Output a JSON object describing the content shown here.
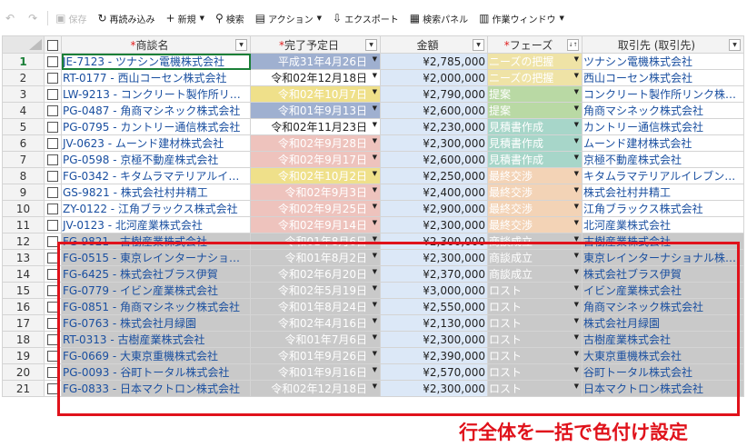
{
  "toolbar": {
    "items": [
      {
        "icon": "undo-icon",
        "glyph": "↶",
        "label": "",
        "disabled": true
      },
      {
        "icon": "redo-icon",
        "glyph": "↷",
        "label": "",
        "disabled": true
      },
      {
        "icon": "save-icon",
        "glyph": "▣",
        "label": "保存",
        "disabled": true
      },
      {
        "icon": "reload-icon",
        "glyph": "↻",
        "label": "再読み込み",
        "disabled": false
      },
      {
        "icon": "plus-icon",
        "glyph": "+",
        "label": "新規",
        "disabled": false,
        "caret": true
      },
      {
        "icon": "search-icon",
        "glyph": "⚲",
        "label": "検索",
        "disabled": false
      },
      {
        "icon": "action-icon",
        "glyph": "▤",
        "label": "アクション",
        "disabled": false,
        "caret": true
      },
      {
        "icon": "export-icon",
        "glyph": "⇩",
        "label": "エクスポート",
        "disabled": false
      },
      {
        "icon": "search-panel-icon",
        "glyph": "▦",
        "label": "検索パネル",
        "disabled": false
      },
      {
        "icon": "work-window-icon",
        "glyph": "▥",
        "label": "作業ウィンドウ",
        "disabled": false,
        "caret": true
      }
    ]
  },
  "grid": {
    "columns": [
      {
        "label": "商談名",
        "required": true
      },
      {
        "label": "完了予定日",
        "required": true
      },
      {
        "label": "金額",
        "required": false
      },
      {
        "label": "フェーズ",
        "required": true,
        "sort": "↓↑"
      },
      {
        "label": "取引先 (取引先)",
        "required": false
      }
    ],
    "filter_glyph": "▼",
    "rows": [
      {
        "n": "1",
        "deal": "JE-7123 - ツナシン電機株式会社",
        "date": "平成31年4月26日",
        "date_bg": "#9fb0d0",
        "amount": "¥2,785,000",
        "phase": "ニーズの把握",
        "phase_bg": "#efe3a6",
        "client": "ツナシン電機株式会社",
        "row_bg": ""
      },
      {
        "n": "2",
        "deal": "RT-0177 - 西山コーセン株式会社",
        "date": "令和02年12月18日",
        "date_bg": "",
        "amount": "¥2,000,000",
        "phase": "ニーズの把握",
        "phase_bg": "#efe3a6",
        "client": "西山コーセン株式会社",
        "row_bg": ""
      },
      {
        "n": "3",
        "deal": "LW-9213 - コンクリート製作所リンク株…",
        "date": "令和02年10月7日",
        "date_bg": "#efe08a",
        "amount": "¥2,790,000",
        "phase": "提案",
        "phase_bg": "#b9d9a4",
        "client": "コンクリート製作所リンク株式会社",
        "row_bg": ""
      },
      {
        "n": "4",
        "deal": "PG-0487 - 角商マシネック株式会社",
        "date": "令和01年9月13日",
        "date_bg": "#9fb0d0",
        "amount": "¥2,600,000",
        "phase": "提案",
        "phase_bg": "#b9d9a4",
        "client": "角商マシネック株式会社",
        "row_bg": ""
      },
      {
        "n": "5",
        "deal": "PG-0795 - カントリー通信株式会社",
        "date": "令和02年11月23日",
        "date_bg": "",
        "amount": "¥2,230,000",
        "phase": "見積書作成",
        "phase_bg": "#a7d6c9",
        "client": "カントリー通信株式会社",
        "row_bg": ""
      },
      {
        "n": "6",
        "deal": "JV-0623 - ムーンド建材株式会社",
        "date": "令和02年9月28日",
        "date_bg": "#eec3bd",
        "amount": "¥2,300,000",
        "phase": "見積書作成",
        "phase_bg": "#a7d6c9",
        "client": "ムーンド建材株式会社",
        "row_bg": ""
      },
      {
        "n": "7",
        "deal": "PG-0598 - 京極不動産株式会社",
        "date": "令和02年9月17日",
        "date_bg": "#eec3bd",
        "amount": "¥2,600,000",
        "phase": "見積書作成",
        "phase_bg": "#a7d6c9",
        "client": "京極不動産株式会社",
        "row_bg": ""
      },
      {
        "n": "8",
        "deal": "FG-0342 - キタムラマテリアルイレブン組合",
        "date": "令和02年10月2日",
        "date_bg": "#efe08a",
        "amount": "¥2,250,000",
        "phase": "最終交渉",
        "phase_bg": "#f3d3b6",
        "client": "キタムラマテリアルイレブン組合",
        "row_bg": ""
      },
      {
        "n": "9",
        "deal": "GS-9821 - 株式会社村井精工",
        "date": "令和02年9月3日",
        "date_bg": "#eec3bd",
        "amount": "¥2,400,000",
        "phase": "最終交渉",
        "phase_bg": "#f3d3b6",
        "client": "株式会社村井精工",
        "row_bg": ""
      },
      {
        "n": "10",
        "deal": "ZY-0122 - 江角ブラックス株式会社",
        "date": "令和02年9月25日",
        "date_bg": "#eec3bd",
        "amount": "¥2,900,000",
        "phase": "最終交渉",
        "phase_bg": "#f3d3b6",
        "client": "江角ブラックス株式会社",
        "row_bg": ""
      },
      {
        "n": "11",
        "deal": "JV-0123 - 北河産業株式会社",
        "date": "令和02年9月14日",
        "date_bg": "#eec3bd",
        "amount": "¥2,300,000",
        "phase": "最終交渉",
        "phase_bg": "#f3d3b6",
        "client": "北河産業株式会社",
        "row_bg": ""
      },
      {
        "n": "12",
        "deal": "FG-9821 - 古樹産業株式会社",
        "date": "令和01年8月6日",
        "date_bg": "",
        "amount": "¥2,300,000",
        "phase": "商談成立",
        "phase_bg": "",
        "client": "古樹産業株式会社",
        "row_bg": "#c9c9c9"
      },
      {
        "n": "13",
        "deal": "FG-0515 - 東京レインターナショナル…",
        "date": "令和01年8月2日",
        "date_bg": "",
        "amount": "¥2,300,000",
        "phase": "商談成立",
        "phase_bg": "",
        "client": "東京レインターナショナル株式会社",
        "row_bg": "#c9c9c9"
      },
      {
        "n": "14",
        "deal": "FG-6425 - 株式会社ブラス伊賀",
        "date": "令和02年6月20日",
        "date_bg": "",
        "amount": "¥2,370,000",
        "phase": "商談成立",
        "phase_bg": "",
        "client": "株式会社ブラス伊賀",
        "row_bg": "#c9c9c9"
      },
      {
        "n": "15",
        "deal": "FG-0779 - イビン産業株式会社",
        "date": "令和02年5月19日",
        "date_bg": "",
        "amount": "¥3,000,000",
        "phase": "ロスト",
        "phase_bg": "",
        "client": "イビン産業株式会社",
        "row_bg": "#c9c9c9"
      },
      {
        "n": "16",
        "deal": "FG-0851 - 角商マシネック株式会社",
        "date": "令和01年8月24日",
        "date_bg": "",
        "amount": "¥2,550,000",
        "phase": "ロスト",
        "phase_bg": "",
        "client": "角商マシネック株式会社",
        "row_bg": "#c9c9c9"
      },
      {
        "n": "17",
        "deal": "FG-0763 - 株式会社月緑園",
        "date": "令和02年4月16日",
        "date_bg": "",
        "amount": "¥2,130,000",
        "phase": "ロスト",
        "phase_bg": "",
        "client": "株式会社月緑園",
        "row_bg": "#c9c9c9"
      },
      {
        "n": "18",
        "deal": "RT-0313 - 古樹産業株式会社",
        "date": "令和01年7月6日",
        "date_bg": "",
        "amount": "¥2,300,000",
        "phase": "ロスト",
        "phase_bg": "",
        "client": "古樹産業株式会社",
        "row_bg": "#c9c9c9"
      },
      {
        "n": "19",
        "deal": "FG-0669 - 大東京重機株式会社",
        "date": "令和01年9月26日",
        "date_bg": "",
        "amount": "¥2,390,000",
        "phase": "ロスト",
        "phase_bg": "",
        "client": "大東京重機株式会社",
        "row_bg": "#c9c9c9"
      },
      {
        "n": "20",
        "deal": "PG-0093 - 谷町トータル株式会社",
        "date": "令和01年9月16日",
        "date_bg": "",
        "amount": "¥2,570,000",
        "phase": "ロスト",
        "phase_bg": "",
        "client": "谷町トータル株式会社",
        "row_bg": "#c9c9c9"
      },
      {
        "n": "21",
        "deal": "FG-0833 - 日本マクトロン株式会社",
        "date": "令和02年12月18日",
        "date_bg": "",
        "amount": "¥2,300,000",
        "phase": "ロスト",
        "phase_bg": "",
        "client": "日本マクトロン株式会社",
        "row_bg": "#c9c9c9"
      }
    ]
  },
  "annotation": {
    "caption": "行全体を一括で色付け設定",
    "color": "#e0121b"
  }
}
